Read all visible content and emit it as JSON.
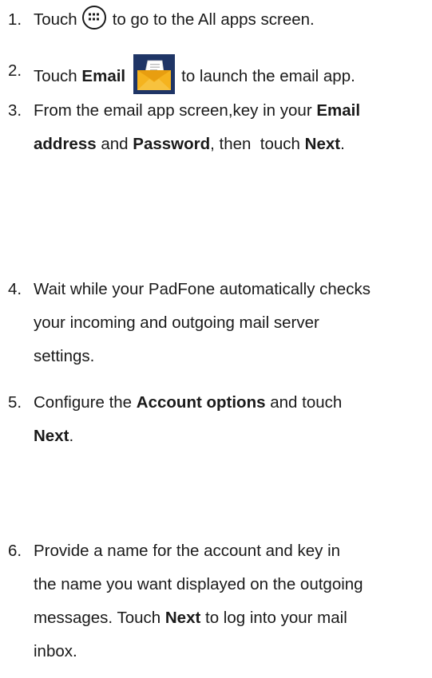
{
  "steps": [
    {
      "number": "1.",
      "pre": "Touch",
      "icon": "all-apps-icon",
      "post": "to go to the All apps screen."
    },
    {
      "number": "2.",
      "pre": "Touch",
      "bold": "Email",
      "icon": "email-app-icon",
      "post": "to launch the email app."
    },
    {
      "number": "3.",
      "line1_text": "From the email app screen,key in your",
      "line1_bold": "Email",
      "line2_bold1": "address",
      "line2_text1": "and",
      "line2_bold2": "Password",
      "line2_text2": ", then  touch",
      "line2_bold3": "Next",
      "line2_text3": "."
    },
    {
      "number": "4.",
      "line1": "Wait while your PadFone automatically checks",
      "line2": "your incoming and outgoing mail server",
      "line3": "settings."
    },
    {
      "number": "5.",
      "line1_text": "Configure the",
      "line1_bold": "Account options",
      "line1_text2": "and touch",
      "line2_bold": "Next",
      "line2_text": "."
    },
    {
      "number": "6.",
      "line1": "Provide a name for the account and key in",
      "line2": "the name you want displayed on the outgoing",
      "line3_text": "messages. Touch",
      "line3_bold": "Next",
      "line3_text2": "to log into your mail",
      "line4": "inbox."
    }
  ],
  "colors": {
    "text": "#1a1a1a",
    "email_icon_bg": "#1f3566",
    "envelope": "#f5b31e",
    "paper": "#ffffff"
  }
}
